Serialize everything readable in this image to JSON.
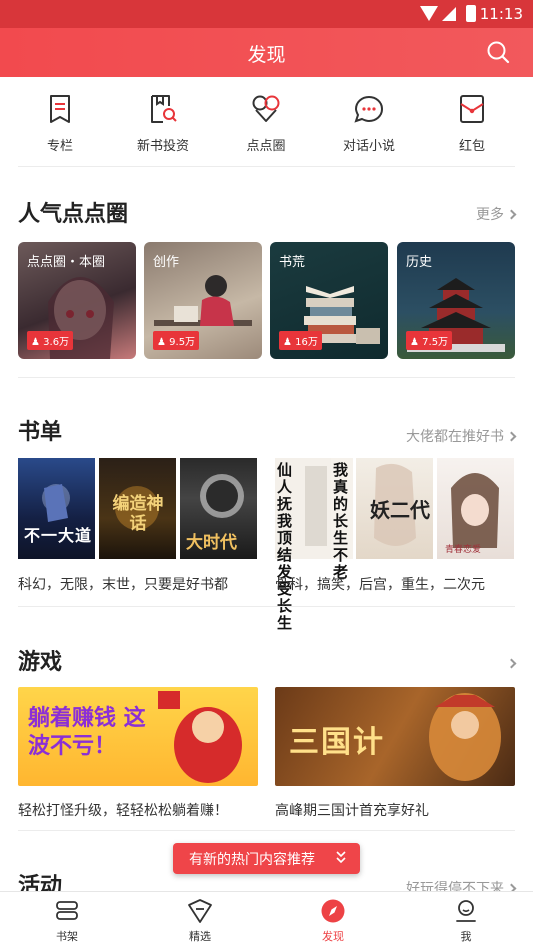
{
  "status_bar": {
    "time": "11:13"
  },
  "header": {
    "title": "发现",
    "search_icon": "search-icon"
  },
  "quick_nav": [
    {
      "label": "专栏",
      "icon": "column-icon"
    },
    {
      "label": "新书投资",
      "icon": "new-book-invest-icon"
    },
    {
      "label": "点点圈",
      "icon": "circle-icon"
    },
    {
      "label": "对话小说",
      "icon": "chat-novel-icon"
    },
    {
      "label": "红包",
      "icon": "red-packet-icon"
    }
  ],
  "popular_circles": {
    "title": "人气点点圈",
    "more": "更多",
    "cards": [
      {
        "title": "点点圈・本圈",
        "count": "3.6万"
      },
      {
        "title": "创作",
        "count": "9.5万"
      },
      {
        "title": "书荒",
        "count": "16万"
      },
      {
        "title": "历史",
        "count": "7.5万"
      }
    ]
  },
  "booklist": {
    "title": "书单",
    "more": "大佬都在推好书",
    "lists": [
      {
        "caption": "科幻，无限，末世，只要是好书都",
        "covers": [
          "不一大道",
          "编造神话",
          "大时代"
        ]
      },
      {
        "caption": "骨科，搞笑，后宫，重生，二次元",
        "covers": [
          "仙人抚我顶 结发受长生",
          "我真的长生不老",
          "妖二代",
          "青春恋爱"
        ]
      }
    ]
  },
  "games": {
    "title": "游戏",
    "items": [
      {
        "banner_text": "躺着赚钱 这波不亏！",
        "caption": "轻松打怪升级，轻轻松松躺着赚！"
      },
      {
        "banner_text": "三国计",
        "caption": "高峰期三国计首充享好礼"
      }
    ]
  },
  "activity": {
    "title": "活动",
    "more": "好玩得停不下来"
  },
  "toast": {
    "text": "有新的热门内容推荐"
  },
  "tab_bar": [
    {
      "label": "书架",
      "icon": "bookshelf-icon",
      "active": false
    },
    {
      "label": "精选",
      "icon": "featured-icon",
      "active": false
    },
    {
      "label": "发现",
      "icon": "discover-icon",
      "active": true
    },
    {
      "label": "我",
      "icon": "profile-icon",
      "active": false
    }
  ],
  "colors": {
    "brand": "#ed4245",
    "header": "#f24a4e",
    "text": "#222222",
    "muted": "#999999"
  }
}
